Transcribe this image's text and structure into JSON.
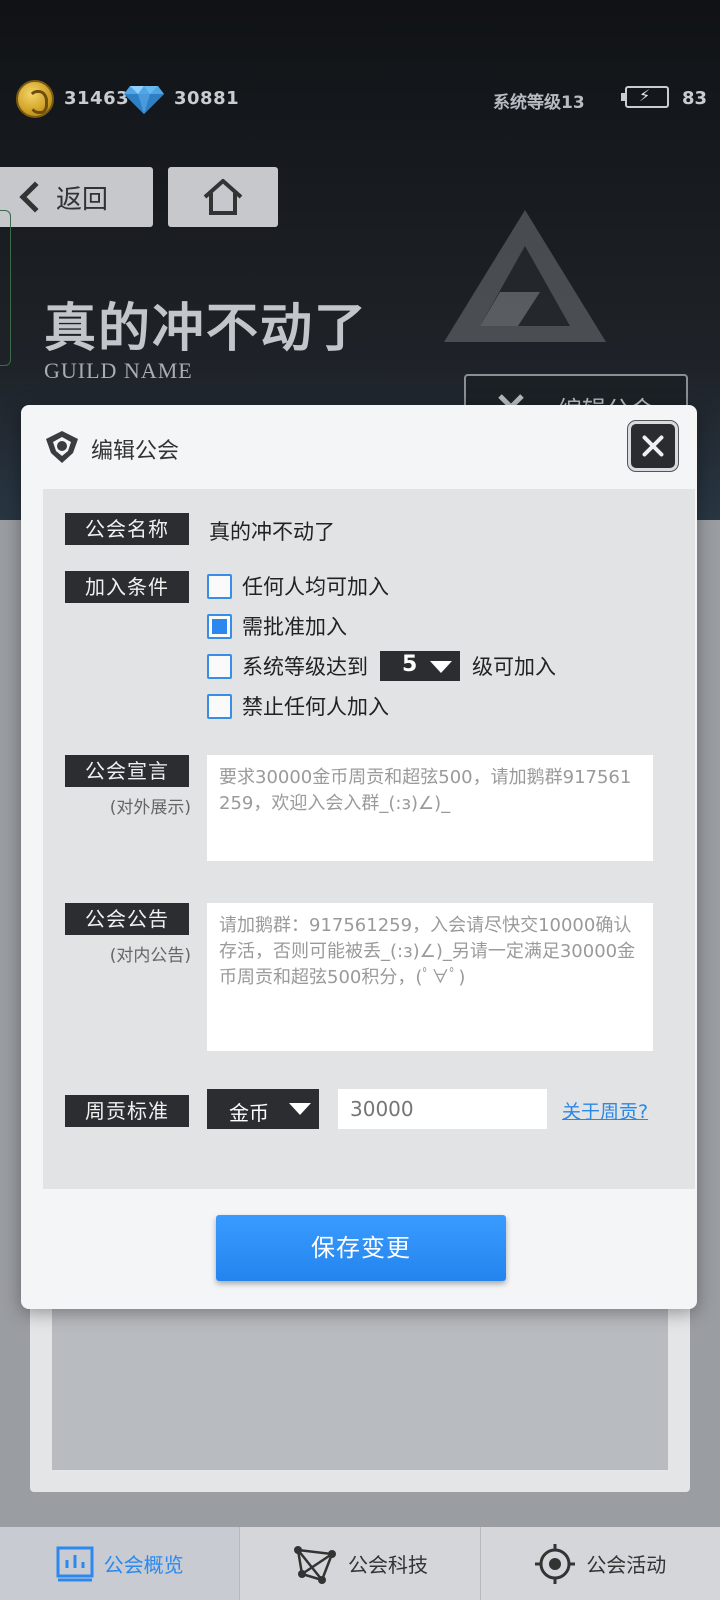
{
  "resources": {
    "coins": "31463",
    "diamonds": "30881",
    "system_level": "系统等级13",
    "energy": "83"
  },
  "nav": {
    "back_label": "返回"
  },
  "guild": {
    "name": "真的冲不动了",
    "subtitle": "GUILD NAME",
    "edit_button_label": "编辑公会"
  },
  "modal": {
    "title": "编辑公会",
    "fields": {
      "name_label": "公会名称",
      "name_value": "真的冲不动了",
      "join_label": "加入条件",
      "join_options": [
        {
          "label": "任何人均可加入",
          "checked": false
        },
        {
          "label": "需批准加入",
          "checked": true
        },
        {
          "label": "系统等级达到",
          "checked": false
        },
        {
          "label": "禁止任何人加入",
          "checked": false
        }
      ],
      "join_level": "5",
      "join_level_suffix": "级可加入",
      "declaration_label": "公会宣言",
      "declaration_sub": "(对外展示)",
      "declaration_text": "要求30000金币周贡和超弦500，请加鹅群917561259，欢迎入会入群_(:з)∠)_",
      "notice_label": "公会公告",
      "notice_sub": "(对内公告)",
      "notice_text": "请加鹅群：917561259，入会请尽快交10000确认存活，否则可能被丢_(:з)∠)_另请一定满足30000金币周贡和超弦500积分，(ﾟ∀ﾟ)",
      "weekly_label": "周贡标准",
      "weekly_currency": "金币",
      "weekly_amount_placeholder": "30000",
      "weekly_link": "关于周贡?"
    },
    "save_label": "保存变更"
  },
  "bottom_tabs": [
    {
      "label": "公会概览",
      "active": true
    },
    {
      "label": "公会科技",
      "active": false
    },
    {
      "label": "公会活动",
      "active": false
    }
  ],
  "colors": {
    "accent": "#2c88ee",
    "dark_label": "#2b2d31"
  }
}
